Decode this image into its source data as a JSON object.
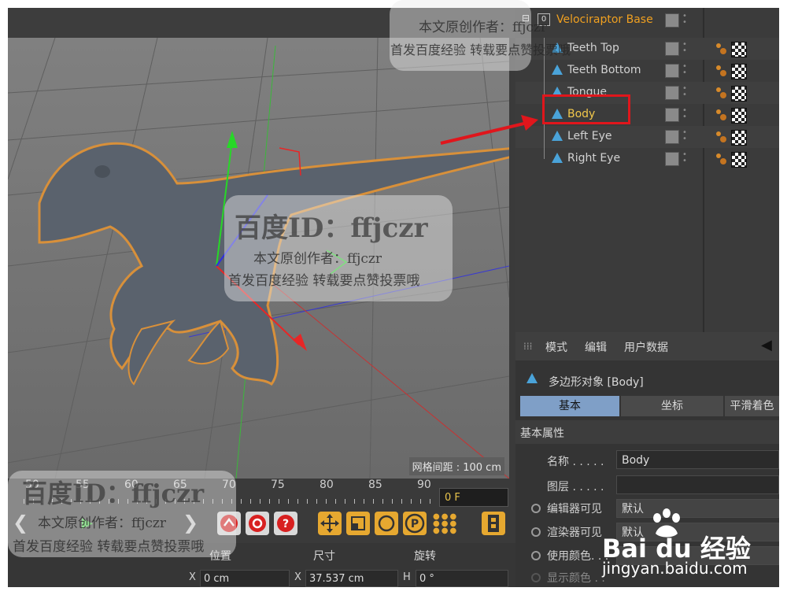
{
  "object_manager": {
    "rows": [
      {
        "name": "Velociraptor Base",
        "color": "#f0a020"
      },
      {
        "name": "Teeth Top",
        "color": "#d2d2d2"
      },
      {
        "name": "Teeth Bottom",
        "color": "#d2d2d2"
      },
      {
        "name": "Tongue",
        "color": "#d2d2d2"
      },
      {
        "name": "Body",
        "color": "#f2c84b"
      },
      {
        "name": "Left Eye",
        "color": "#d2d2d2"
      },
      {
        "name": "Right Eye",
        "color": "#d2d2d2"
      }
    ],
    "expand_label": "0"
  },
  "viewport": {
    "grid_label": "网格间距 : 100 cm"
  },
  "attribute_manager": {
    "menu": [
      "模式",
      "编辑",
      "用户数据"
    ],
    "object_title": "多边形对象 [Body]",
    "tabs": [
      "基本",
      "坐标",
      "平滑着色"
    ],
    "section_title": "基本属性",
    "props": {
      "name_label": "名称 . . . . .",
      "name_value": "Body",
      "layer_label": "图层 . . . . .",
      "layer_value": "",
      "editor_visible_label": "编辑器可见",
      "editor_visible_value": "默认",
      "render_visible_label": "渲染器可见",
      "render_visible_value": "默认",
      "use_color_label": "使用颜色. . .",
      "display_color_label": "显示颜色 . ."
    }
  },
  "timeline": {
    "ticks": [
      "50",
      "55",
      "60",
      "65",
      "70",
      "75",
      "80",
      "85",
      "90"
    ],
    "current_frame": "0 F"
  },
  "coordinates": {
    "headers": [
      "位置",
      "尺寸",
      "旋转"
    ],
    "x_label": "X",
    "pos_x": "0 cm",
    "size_x_label": "X",
    "size_x": "37.537 cm",
    "rot_label": "H",
    "rot_h": "0 °"
  },
  "watermarks": {
    "baidu_id": "百度ID：ffjczr",
    "author": "本文原创作者：ffjczr",
    "first_publish": "首发百度经验 转载要点赞投票哦",
    "logo_text": "Bai du 经验",
    "site": "jingyan.baidu.com"
  },
  "colors": {
    "accent_blue": "#7f9fc7",
    "highlight_box": "#e0161c",
    "body_selected": "#f2c84b"
  }
}
